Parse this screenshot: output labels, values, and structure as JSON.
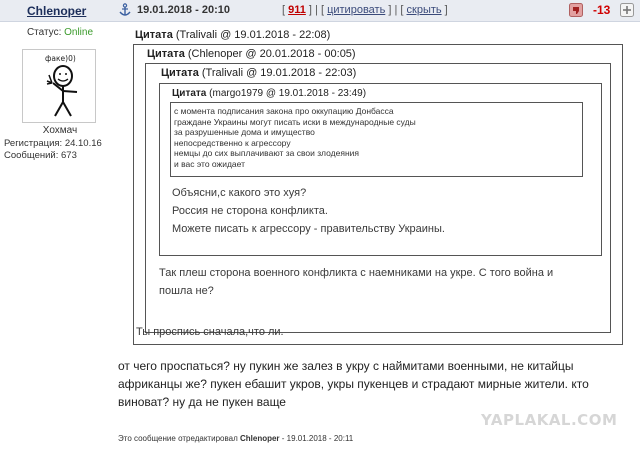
{
  "header": {
    "author": "Chlenoper",
    "date": "19.01.2018 - 20:10",
    "post_number": "911",
    "cite_label": "цитировать",
    "hide_label": "скрыть",
    "rating": "-13",
    "colors": {
      "header_bg": "#e9ecf2",
      "rating": "#d00000",
      "post_number": "#c00000"
    }
  },
  "user": {
    "status_label": "Статус:",
    "status_value": "Online",
    "avatar_caption": "факе)0)",
    "name_below_avatar": "Хохмач",
    "registration": "Регистрация: 24.10.16",
    "messages": "Сообщений: 673"
  },
  "quotes": {
    "q1": {
      "label": "Цитата",
      "meta": "(Tralivali @ 19.01.2018 - 22:08)"
    },
    "q2": {
      "label": "Цитата",
      "meta": "(Chlenoper @ 20.01.2018 - 00:05)"
    },
    "q3": {
      "label": "Цитата",
      "meta": "(Tralivali @ 19.01.2018 - 22:03)"
    },
    "q4": {
      "label": "Цитата",
      "meta": "(margo1979 @ 19.01.2018 - 23:49)",
      "lines": [
        "с момента подписания закона про оккупацию Донбасса",
        "граждане Украины могут писать иски в международные суды",
        "за разрушенные дома и имущество",
        "непосредственно к агрессору",
        "немцы до сих выплачивают за свои злодеяния",
        "и вас это ожидает"
      ]
    },
    "q3_reply": [
      "Объясни,с какого это хуя?",
      "Россия не сторона конфликта.",
      "Можете писать к агрессору - правительству Украины."
    ],
    "q2_reply": [
      "Так плеш сторона военного конфликта с наемниками на укре. С того война и",
      "пошла не?"
    ],
    "q1_reply": "Ты проспись сначала,что ли."
  },
  "post_body": [
    "от чего проспаться? ну пукин же залез в укру с найми­тами военными, не китайцы",
    "африканцы же? пукен ебашит укров, укры пукенцев и страдают мирные жители. кто",
    "виноват? ну да не пукен ваще"
  ],
  "edited": {
    "prefix": "Это сообщение отредактировал",
    "author": "Chlenoper",
    "date": "- 19.01.2018 - 20:11"
  },
  "watermark": "YAPLAKAL.COM"
}
